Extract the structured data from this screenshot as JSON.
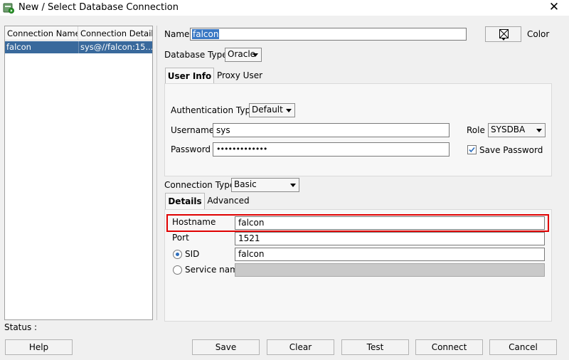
{
  "window": {
    "title": "New / Select Database Connection",
    "close_glyph": "✕",
    "icon": "database-connection-icon"
  },
  "connection_list": {
    "columns": [
      "Connection Name",
      "Connection Details"
    ],
    "rows": [
      {
        "name": "falcon",
        "details": "sys@//falcon:15..."
      }
    ]
  },
  "form": {
    "name_label": "Name",
    "name_value": "falcon",
    "color_label": "Color",
    "database_type_label": "Database Type",
    "database_type_value": "Oracle",
    "tabs": [
      "User Info",
      "Proxy User"
    ],
    "auth_type_label": "Authentication Type",
    "auth_type_value": "Default",
    "username_label": "Username",
    "username_value": "sys",
    "password_label": "Password",
    "password_value": "•••••••••••••",
    "role_label": "Role",
    "role_value": "SYSDBA",
    "save_password_label": "Save Password",
    "save_password_checked": true,
    "connection_type_label": "Connection Type",
    "connection_type_value": "Basic",
    "detail_tabs": [
      "Details",
      "Advanced"
    ],
    "hostname_label": "Hostname",
    "hostname_value": "falcon",
    "port_label": "Port",
    "port_value": "1521",
    "sid_label": "SID",
    "sid_value": "falcon",
    "service_name_label": "Service name",
    "service_name_value": "",
    "selected_radio": "SID"
  },
  "status": {
    "label": "Status :"
  },
  "buttons": {
    "help": "Help",
    "save": "Save",
    "clear": "Clear",
    "test": "Test",
    "connect": "Connect",
    "cancel": "Cancel"
  },
  "colors": {
    "selection": "#39699c",
    "highlight_border": "#e00000"
  }
}
